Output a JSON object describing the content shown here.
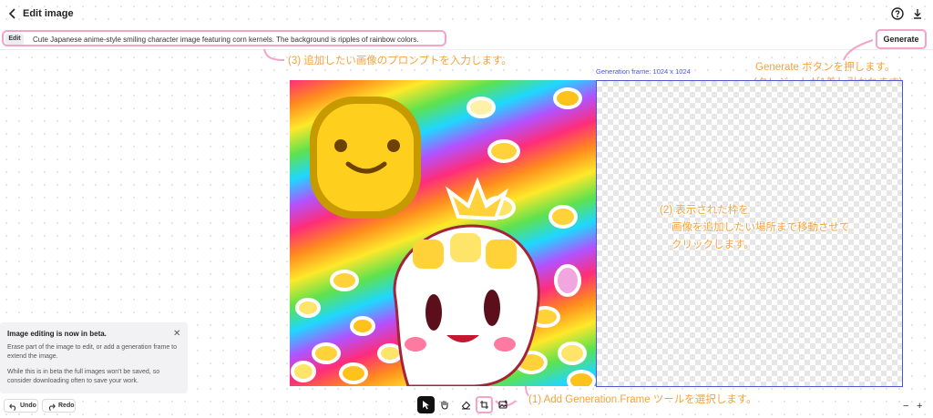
{
  "header": {
    "title": "Edit image",
    "back_icon": "chevron-left-icon",
    "help_icon": "help-circle-icon",
    "download_icon": "download-icon"
  },
  "prompt": {
    "tag": "Edit",
    "text": "Cute Japanese anime-style smiling character image featuring corn kernels. The background is ripples of rainbow colors.",
    "generate_label": "Generate"
  },
  "canvas": {
    "frame_label": "Generation frame: 1024 x 1024"
  },
  "annotations": {
    "step3": "(3) 追加したい画像のプロンプトを入力します。",
    "generate_line1": "Generate ボタンを押します。",
    "generate_line2": "(クレジットが1差し引かれます)",
    "step2_line1": "(2) 表示された枠を",
    "step2_line2": "画像を追加したい場所まで移動させて",
    "step2_line3": "クリックします。",
    "step1": "(1) Add Generation Frame ツールを選択します。",
    "color": "#f6a23c",
    "highlight_color": "#f5a3c7"
  },
  "beta_panel": {
    "title": "Image editing is now in beta.",
    "p1": "Erase part of the image to edit, or add a generation frame to extend the image.",
    "p2": "While this is in beta the full images won't be saved, so consider downloading often to save your work."
  },
  "history": {
    "undo": "Undo",
    "redo": "Redo"
  },
  "toolbar": {
    "tools": [
      "select-tool-icon",
      "hand-tool-icon",
      "eraser-tool-icon",
      "add-generation-frame-icon",
      "upload-image-icon"
    ],
    "active_tool": "select-tool-icon"
  },
  "zoom": {
    "out": "−",
    "in": "+"
  },
  "colors": {
    "frame": "#4a58d6"
  }
}
